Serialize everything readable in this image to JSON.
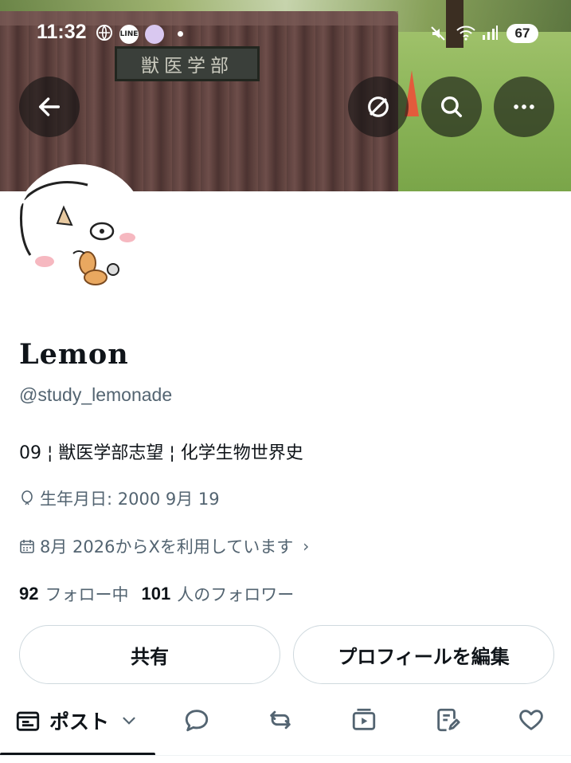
{
  "status_bar": {
    "time": "11:32",
    "line_label": "LINE",
    "battery": "67"
  },
  "banner": {
    "plate_text": "獣医学部"
  },
  "actions": {
    "back_icon": "arrow-left-icon",
    "grok_icon": "grok-icon",
    "search_icon": "search-icon",
    "more_icon": "more-icon"
  },
  "profile": {
    "name": "Lemon",
    "handle": "@study_lemonade",
    "bio": "09 ¦ 獣医学部志望 ¦ 化学生物世界史",
    "birthday": "生年月日: 2000 9月 19",
    "joined": "8月 2026からXを利用しています",
    "joined_chevron": "›",
    "following_count": "92",
    "following_label": "フォロー中",
    "followers_count": "101",
    "followers_label": "人のフォロワー"
  },
  "buttons": {
    "share": "共有",
    "edit_profile": "プロフィールを編集"
  },
  "tabs": {
    "posts_label": "ポスト"
  },
  "colors": {
    "text_primary": "#0f1419",
    "text_secondary": "#536471",
    "border": "#cfd9de",
    "highlight": "#fff050"
  }
}
